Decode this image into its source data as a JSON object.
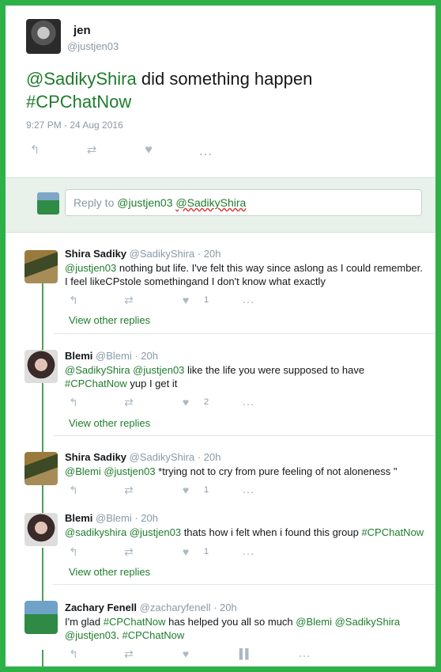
{
  "main_tweet": {
    "name": "jen",
    "handle": "@justjen03",
    "text_mention": "@SadikyShira",
    "text_body": " did something happen ",
    "text_hashtag": "#CPChatNow",
    "timestamp": "9:27 PM - 24 Aug 2016"
  },
  "reply_box": {
    "placeholder_prefix": "Reply to ",
    "mention1": "@justjen03",
    "mention2": "@SadikyShira"
  },
  "replies": [
    {
      "name": "Shira Sadiky",
      "meta": "@SadikyShira · 20h",
      "mention": "@justjen03",
      "text": " nothing but life. I've felt this way since aslong as I could remember. I feel likeCPstole somethingand I don't know what exactly",
      "likes": "1",
      "retweets": "",
      "view_other": "View other replies"
    },
    {
      "name": "Blemi",
      "meta": "@Blemi · 20h",
      "mention": "@SadikyShira @justjen03",
      "text": " like the life you were supposed to have ",
      "hashtag": "#CPChatNow",
      "text_end": " yup I get it",
      "likes": "2",
      "view_other": "View other replies"
    },
    {
      "name": "Shira Sadiky",
      "meta": "@SadikyShira · 20h",
      "mention": "@Blemi @justjen03",
      "text": " *trying not to cry from pure feeling of not aloneness \"",
      "likes": "1"
    },
    {
      "name": "Blemi",
      "meta": "@Blemi · 20h",
      "mention": "@sadikyshira @justjen03",
      "text": " thats how i felt when i found this group ",
      "hashtag": "#CPChatNow",
      "likes": "1",
      "view_other": "View other replies"
    },
    {
      "name": "Zachary Fenell",
      "meta": "@zacharyfenell · 20h",
      "text_start": "I'm glad ",
      "hashtag": "#CPChatNow",
      "text_mid": " has helped you all so much ",
      "mention": "@Blemi @SadikyShira",
      "mention2": "@justjen03",
      "text_end": ". ",
      "hashtag2": "#CPChatNow"
    }
  ],
  "icons": {
    "reply": "reply-icon",
    "retweet": "retweet-icon",
    "like": "heart-icon",
    "more": "more-icon",
    "analytics": "analytics-icon"
  },
  "colors": {
    "accent": "#1e7c2c",
    "frame": "#2fb14a",
    "reply_bg": "#e8f2ea"
  }
}
